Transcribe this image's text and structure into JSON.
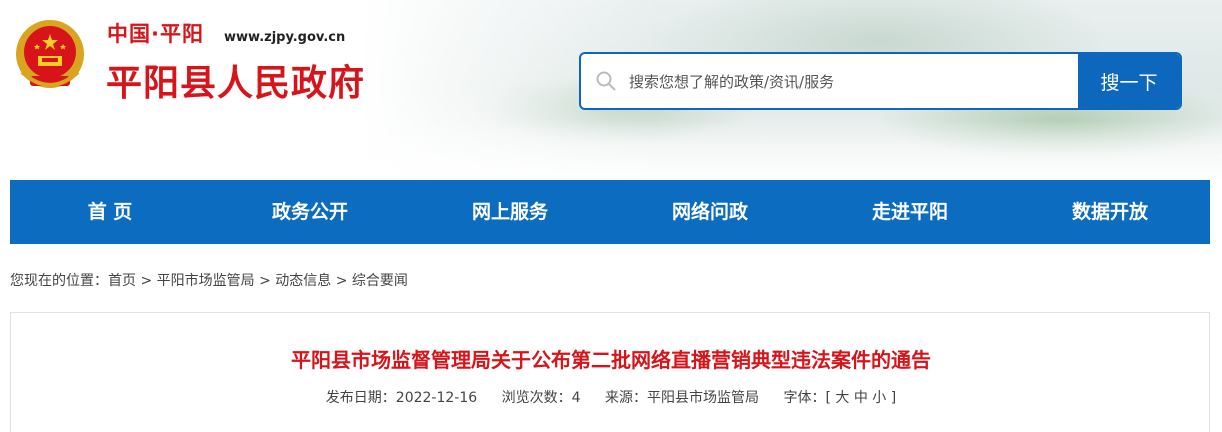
{
  "header": {
    "site_small": "中国·平阳",
    "site_url": "www.zjpy.gov.cn",
    "site_title": "平阳县人民政府",
    "emblem_icon": "national-emblem-icon"
  },
  "search": {
    "placeholder": "搜索您想了解的政策/资讯/服务",
    "button_label": "搜一下"
  },
  "nav": {
    "items": [
      {
        "label": "首 页"
      },
      {
        "label": "政务公开"
      },
      {
        "label": "网上服务"
      },
      {
        "label": "网络问政"
      },
      {
        "label": "走进平阳"
      },
      {
        "label": "数据开放"
      }
    ]
  },
  "breadcrumb": {
    "prefix": "您现在的位置：",
    "items": [
      "首页",
      "平阳市场监管局",
      "动态信息",
      "综合要闻"
    ],
    "separator": " > "
  },
  "article": {
    "title": "平阳县市场监督管理局关于公布第二批网络直播营销典型违法案件的通告",
    "publish_date": "发布日期：2022-12-16",
    "views": "浏览次数：4",
    "source": "来源：平阳县市场监管局",
    "font_size": "字体：[ 大 中 小 ]"
  },
  "colors": {
    "brand_red": "#d7141a",
    "brand_blue": "#0b6cc0"
  }
}
